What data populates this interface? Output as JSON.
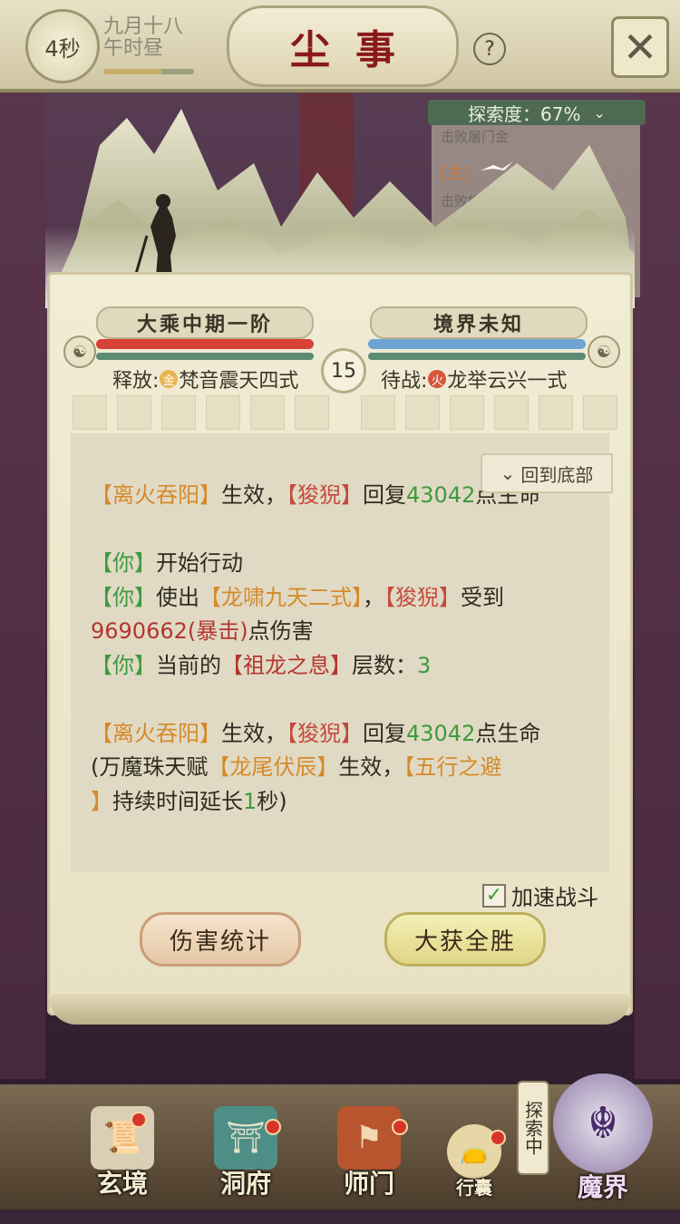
{
  "header": {
    "timer": "4秒",
    "date_line1": "九月十八",
    "date_line2": "午时昼",
    "title": "尘事",
    "help_icon": "question-mark-icon",
    "close_icon": "crossed-swords-close-icon"
  },
  "explore": {
    "label": "探索度：67%",
    "quest1": "击败屠门金",
    "quest2_tag": "[主]",
    "quest3": "击败蝎吻"
  },
  "battle": {
    "player_realm": "大乘中期一阶",
    "enemy_realm": "境界未知",
    "round": "15",
    "player_skill_prefix": "释放:",
    "player_skill_element": "金",
    "player_skill": "梵音震天四式",
    "enemy_skill_prefix": "待战:",
    "enemy_skill_element": "火",
    "enemy_skill": "龙举云兴一式"
  },
  "log": {
    "back_to_bottom": "回到底部",
    "l1": {
      "a": "【离火吞阳】",
      "b": "生效，",
      "c": "【狻猊】",
      "d": "回复",
      "e": "43042",
      "f": "点生命"
    },
    "l2": {
      "a": "【你】",
      "b": "开始行动"
    },
    "l3": {
      "a": "【你】",
      "b": "使出",
      "c": "【龙啸九天二式】",
      "d": "，",
      "e": "【狻猊】",
      "f": "受到"
    },
    "l4": {
      "a": "9690662(暴击)",
      "b": "点伤害"
    },
    "l5": {
      "a": "【你】",
      "b": "当前的",
      "c": "【祖龙之息】",
      "d": "层数：",
      "e": "3"
    },
    "l6": {
      "a": "【离火吞阳】",
      "b": "生效，",
      "c": "【狻猊】",
      "d": "回复",
      "e": "43042",
      "f": "点生命"
    },
    "l7": {
      "a": "(万魔珠天赋",
      "b": "【龙尾伏辰】",
      "c": "生效，",
      "d": "【五行之避"
    },
    "l8": {
      "a": "】",
      "b": "持续时间延长",
      "c": "1",
      "d": "秒)"
    }
  },
  "controls": {
    "speed_label": "加速战斗",
    "speed_checked": true,
    "stats_button": "伤害统计",
    "win_button": "大获全胜"
  },
  "nav": {
    "items": [
      {
        "label": "玄境",
        "icon": "scroll-icon"
      },
      {
        "label": "洞府",
        "icon": "pavilion-icon"
      },
      {
        "label": "师门",
        "icon": "banner-icon"
      },
      {
        "label": "行囊",
        "icon": "bag-icon"
      },
      {
        "label": "魔界",
        "icon": "demon-icon"
      }
    ],
    "exploring": "探索中"
  },
  "colors": {
    "hp": "#d84138",
    "mana": "#6ea4d4",
    "accent": "#d68a2a",
    "enemy": "#c44a3c",
    "number": "#3f9a3e"
  }
}
